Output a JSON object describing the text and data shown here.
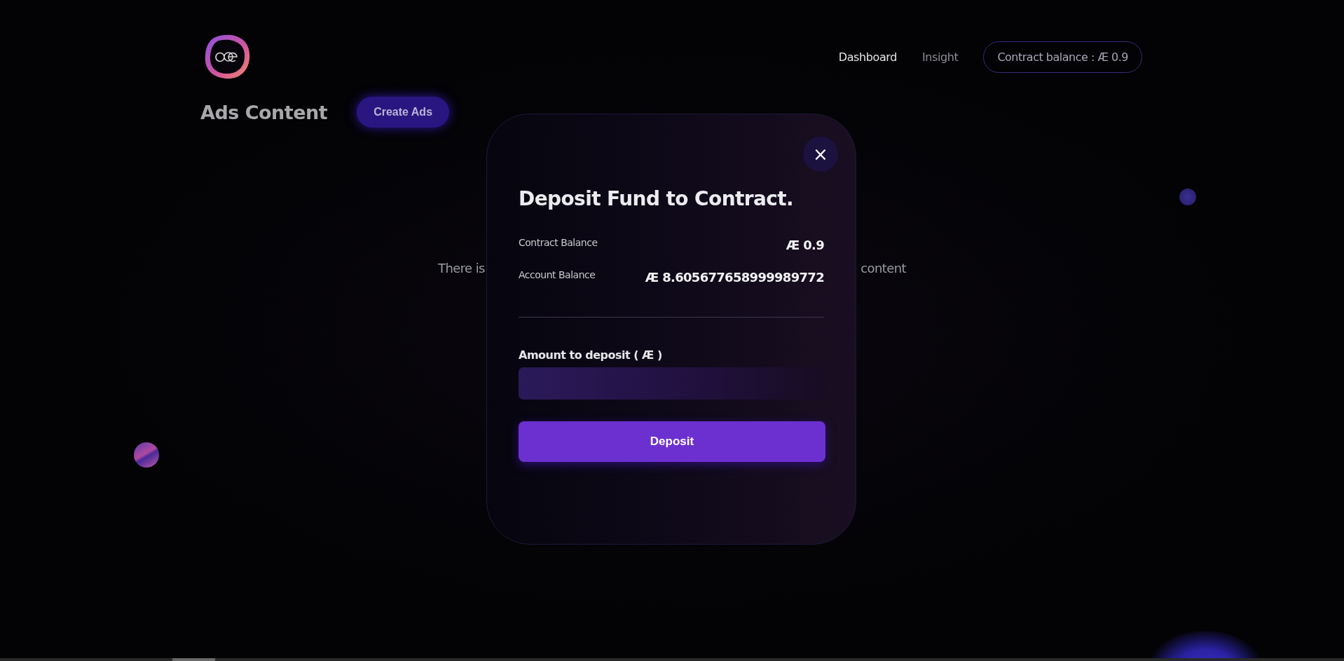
{
  "header": {
    "nav": [
      {
        "label": "Dashboard",
        "selected": true
      },
      {
        "label": "Insight",
        "selected": false
      }
    ],
    "balance_pill": "Contract balance : Æ 0.9"
  },
  "page": {
    "title": "Ads Content",
    "create_button": "Create Ads",
    "empty_text_left": "There is",
    "empty_text_right": "content"
  },
  "modal": {
    "close": "×",
    "title": "Deposit Fund to Contract.",
    "rows": [
      {
        "label": "Contract Balance",
        "value": "Æ 0.9"
      },
      {
        "label": "Account Balance",
        "value": "Æ 8.605677658999989772"
      }
    ],
    "field_label": "Amount to deposit ( Æ )",
    "submit": "Deposit"
  }
}
